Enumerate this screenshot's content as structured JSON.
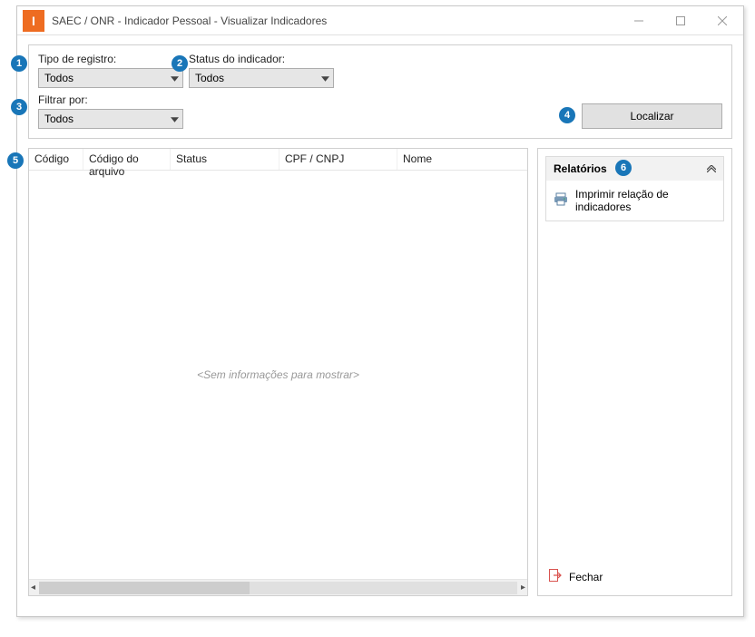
{
  "window": {
    "title": "SAEC / ONR - Indicador Pessoal - Visualizar Indicadores"
  },
  "filters": {
    "tipo_registro": {
      "label": "Tipo de registro:",
      "value": "Todos"
    },
    "status_indicador": {
      "label": "Status do indicador:",
      "value": "Todos"
    },
    "filtrar_por": {
      "label": "Filtrar por:",
      "value": "Todos"
    },
    "localizar": "Localizar"
  },
  "grid": {
    "columns": [
      "Código",
      "Código do arquivo",
      "Status",
      "CPF / CNPJ",
      "Nome"
    ],
    "empty": "<Sem informações para mostrar>"
  },
  "reports": {
    "header": "Relatórios",
    "print_item": "Imprimir relação de indicadores"
  },
  "close": "Fechar",
  "badges": {
    "b1": "1",
    "b2": "2",
    "b3": "3",
    "b4": "4",
    "b5": "5",
    "b6": "6"
  }
}
